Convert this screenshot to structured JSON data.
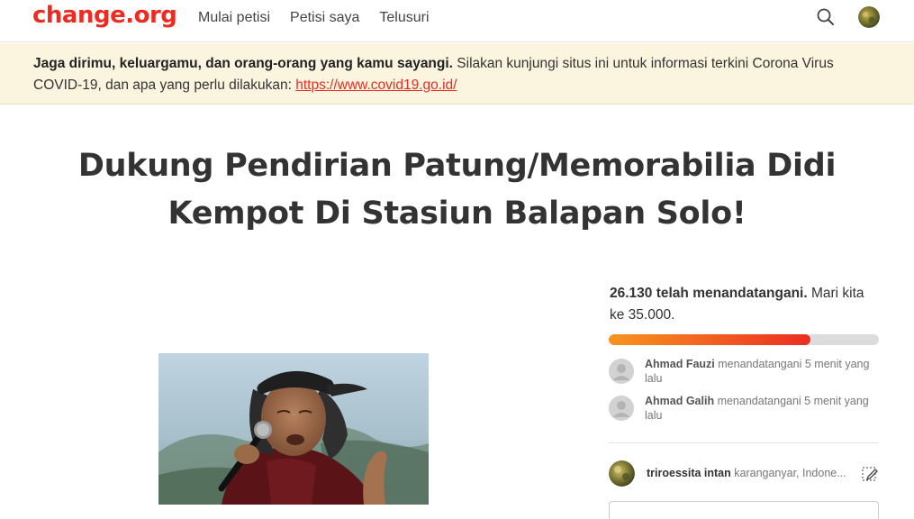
{
  "header": {
    "logo": "change.org",
    "nav": [
      "Mulai petisi",
      "Petisi saya",
      "Telusuri"
    ],
    "search_icon": "search-icon",
    "avatar_icon": "user-avatar"
  },
  "banner": {
    "bold_text": "Jaga dirimu, keluargamu, dan orang-orang yang kamu sayangi.",
    "text": " Silakan kunjungi situs ini untuk informasi terkini Corona Virus COVID-19, dan apa yang perlu dilakukan: ",
    "link": "https://www.covid19.go.id/"
  },
  "petition": {
    "title": "Dukung Pendirian Patung/Memorabilia Didi Kempot Di Stasiun Balapan Solo!"
  },
  "signatures": {
    "count_text": "26.130 telah menandatangani.",
    "goal_text": " Mari kita ke 35.000.",
    "progress": 0.7466,
    "bar_colors": [
      "#f79520",
      "#ec2c22"
    ]
  },
  "recent_signers": [
    {
      "name": "Ahmad Fauzi",
      "action": " menandatangani 5 menit yang lalu"
    },
    {
      "name": "Ahmad Galih",
      "action": " menandatangani 5 menit yang lalu"
    }
  ],
  "current_user": {
    "name": "triroessita intan",
    "location": " karanganyar, Indone..."
  },
  "colors": {
    "brand": "#ec2c22",
    "banner_bg": "#fbf4de"
  }
}
